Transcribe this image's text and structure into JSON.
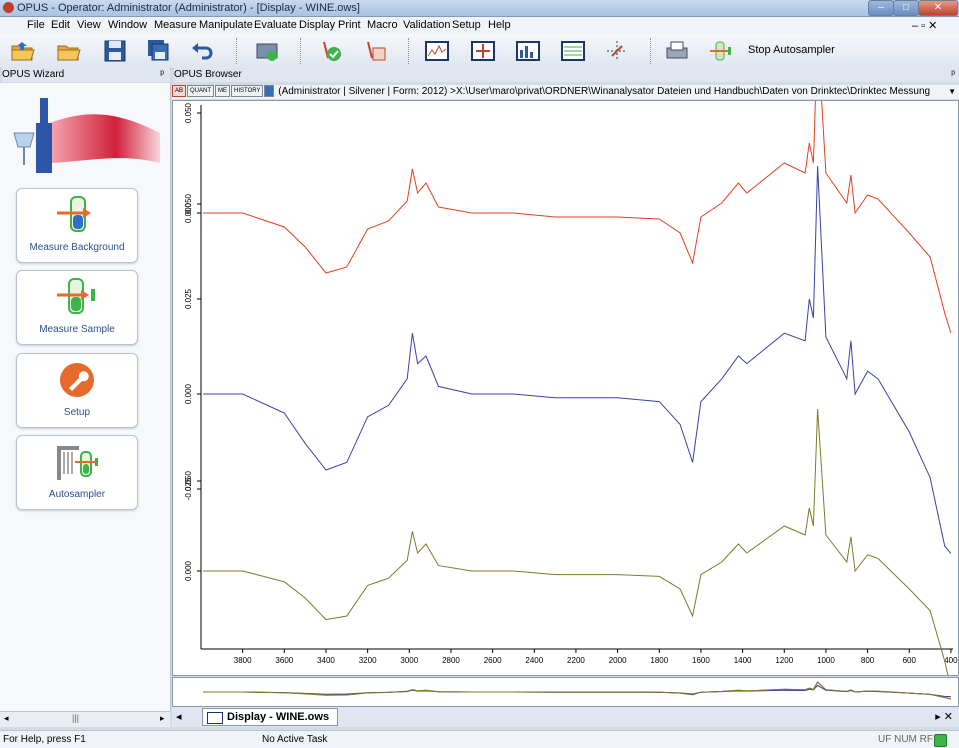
{
  "window": {
    "title": "OPUS - Operator: Administrator  (Administrator) - [Display - WINE.ows]",
    "min": "–",
    "max": "□",
    "close": "✕"
  },
  "menu": [
    "File",
    "Edit",
    "View",
    "Window",
    "Measure",
    "Manipulate",
    "Evaluate",
    "Display",
    "Print",
    "Macro",
    "Validation",
    "Setup",
    "Help"
  ],
  "mdi_controls": "– ▫ ✕",
  "toolbar": {
    "stop_label": "Stop Autosampler"
  },
  "wizard": {
    "header": "OPUS Wizard",
    "pin": "ᵖ",
    "items": [
      "Measure Background",
      "Measure Sample",
      "Setup",
      "Autosampler"
    ]
  },
  "browser": {
    "header": "OPUS Browser",
    "pin": "ᵖ",
    "mini_buttons": [
      "AB",
      "QUANT",
      "ME",
      "HISTORY"
    ],
    "path": "(Administrator | Silvener |  Form: 2012) >X:\\User\\maro\\privat\\ORDNER\\Winanalysator Dateien und Handbuch\\Daten von Drinktec\\Drinktec Messung"
  },
  "chart_data": {
    "type": "line",
    "x_ticks": [
      3800,
      3600,
      3400,
      3200,
      3000,
      2800,
      2600,
      2400,
      2200,
      2000,
      1800,
      1600,
      1400,
      1200,
      1000,
      800,
      600,
      400
    ],
    "xlim": [
      4000,
      390
    ],
    "series": [
      {
        "color": "#e0411f",
        "y_ticks": [
          "0.050",
          "0.000"
        ],
        "x": [
          3990,
          3800,
          3600,
          3500,
          3400,
          3300,
          3200,
          3100,
          3010,
          2985,
          2960,
          2920,
          2860,
          2700,
          2500,
          2300,
          2000,
          1800,
          1700,
          1640,
          1600,
          1500,
          1420,
          1380,
          1200,
          1100,
          1080,
          1060,
          1040,
          1000,
          900,
          880,
          860,
          800,
          750,
          600,
          500,
          430,
          400
        ],
        "y": [
          0.0,
          0.0,
          -0.007,
          -0.017,
          -0.03,
          -0.027,
          -0.008,
          -0.004,
          0.006,
          0.022,
          0.01,
          0.015,
          0.003,
          0.0,
          0.0,
          -0.002,
          -0.002,
          -0.003,
          -0.01,
          -0.025,
          -0.002,
          0.005,
          0.015,
          0.01,
          0.025,
          0.02,
          0.035,
          0.025,
          0.09,
          0.02,
          0.005,
          0.019,
          0.0,
          0.009,
          0.007,
          -0.01,
          -0.022,
          -0.05,
          -0.06
        ]
      },
      {
        "color": "#3a40a6",
        "y_ticks": [
          "0.050",
          "0.025",
          "0.000",
          "-0.025"
        ],
        "x": [
          3990,
          3800,
          3600,
          3500,
          3400,
          3300,
          3200,
          3100,
          3010,
          2985,
          2960,
          2920,
          2860,
          2700,
          2500,
          2300,
          2000,
          1800,
          1700,
          1640,
          1600,
          1500,
          1420,
          1380,
          1200,
          1100,
          1080,
          1060,
          1040,
          1000,
          900,
          880,
          860,
          800,
          750,
          600,
          500,
          430,
          400
        ],
        "y": [
          0.0,
          0.0,
          -0.005,
          -0.013,
          -0.02,
          -0.018,
          -0.006,
          -0.003,
          0.004,
          0.016,
          0.008,
          0.01,
          0.002,
          0.0,
          0.0,
          -0.001,
          -0.001,
          -0.002,
          -0.008,
          -0.018,
          -0.002,
          0.004,
          0.01,
          0.008,
          0.016,
          0.014,
          0.025,
          0.02,
          0.06,
          0.015,
          0.004,
          0.014,
          0.0,
          0.006,
          0.004,
          -0.01,
          -0.022,
          -0.04,
          -0.042
        ]
      },
      {
        "color": "#7c7a2b",
        "y_ticks": [
          "0.050",
          "0.000"
        ],
        "x": [
          3990,
          3800,
          3600,
          3500,
          3400,
          3300,
          3200,
          3100,
          3010,
          2985,
          2960,
          2920,
          2860,
          2700,
          2500,
          2300,
          2000,
          1800,
          1700,
          1640,
          1600,
          1500,
          1420,
          1380,
          1200,
          1100,
          1080,
          1060,
          1040,
          1000,
          900,
          880,
          860,
          800,
          750,
          600,
          500,
          430,
          400
        ],
        "y": [
          0.0,
          0.0,
          -0.006,
          -0.015,
          -0.027,
          -0.025,
          -0.008,
          -0.004,
          0.006,
          0.022,
          0.01,
          0.015,
          0.003,
          0.0,
          0.0,
          -0.002,
          -0.002,
          -0.003,
          -0.01,
          -0.025,
          -0.002,
          0.005,
          0.015,
          0.01,
          0.025,
          0.02,
          0.035,
          0.025,
          0.09,
          0.02,
          0.005,
          0.019,
          0.0,
          0.009,
          0.007,
          -0.01,
          -0.022,
          -0.05,
          -0.065
        ]
      }
    ]
  },
  "tab": {
    "label": "Display - WINE.ows",
    "nav_left": "◂",
    "nav_right": "▸ ✕"
  },
  "status": {
    "help": "For Help, press F1",
    "task": "No Active Task",
    "indicators": "UF NUM RF"
  }
}
